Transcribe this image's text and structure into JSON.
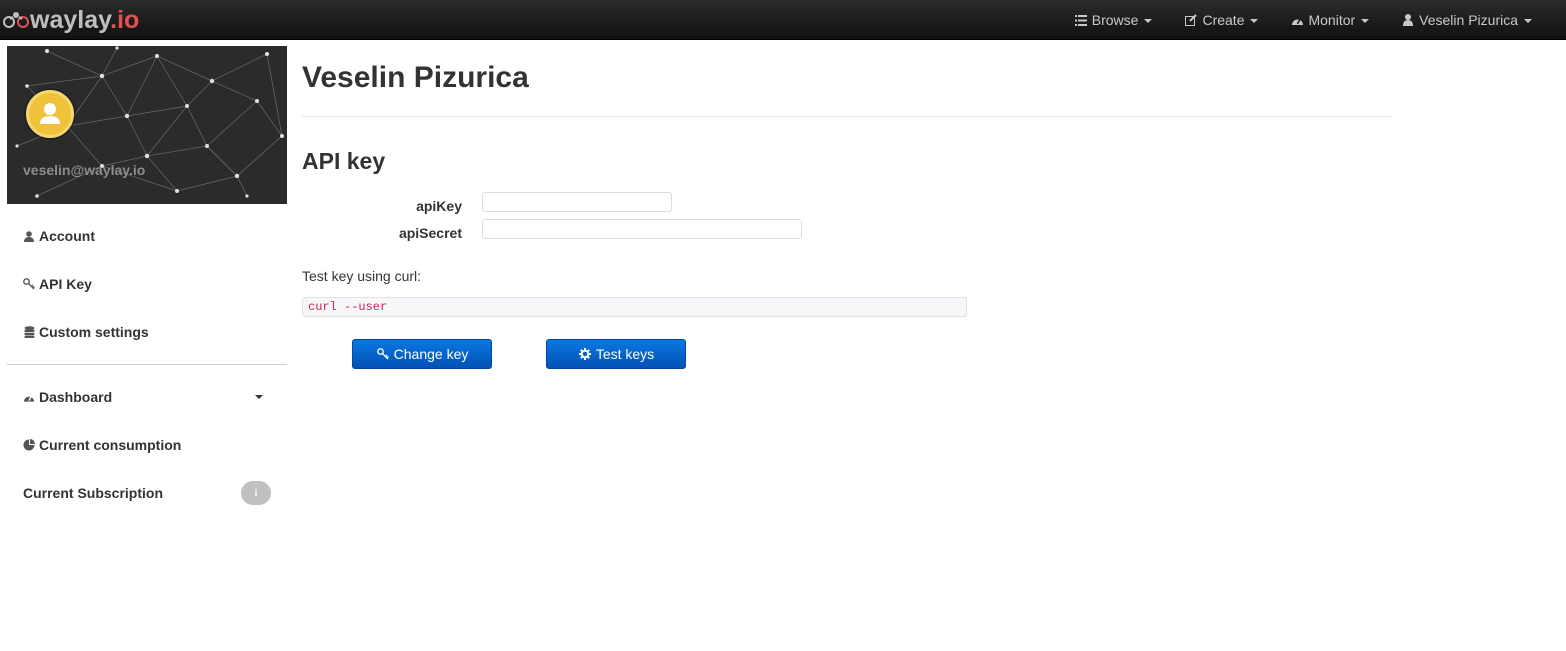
{
  "brand": {
    "name": "waylay",
    "tld": ".io",
    "logo_icon": "waylay-logo-icon"
  },
  "navbar": {
    "items": [
      {
        "label": "Browse",
        "icon": "list-icon"
      },
      {
        "label": "Create",
        "icon": "edit-icon"
      },
      {
        "label": "Monitor",
        "icon": "dashboard-icon"
      },
      {
        "label": "Veselin Pizurica",
        "icon": "user-icon"
      }
    ]
  },
  "sidebar": {
    "email": "veselin@waylay.io",
    "items": [
      {
        "label": "Account",
        "icon": "user-icon"
      },
      {
        "label": "API Key",
        "icon": "key-icon"
      },
      {
        "label": "Custom settings",
        "icon": "database-icon"
      }
    ],
    "items2": [
      {
        "label": "Dashboard",
        "icon": "dashboard-icon"
      },
      {
        "label": "Current consumption",
        "icon": "pie-chart-icon"
      },
      {
        "label": "Current Subscription",
        "badge": "i"
      }
    ]
  },
  "main": {
    "title": "Veselin Pizurica",
    "section_title": "API key",
    "api_key_label": "apiKey",
    "api_secret_label": "apiSecret",
    "curl_label": "Test key using curl:",
    "curl_command": "curl --user",
    "buttons": {
      "change_key": "Change key",
      "test_keys": "Test keys"
    }
  },
  "colors": {
    "navbar_bg": "#1a1a1a",
    "brand_tld": "#e8504f",
    "primary_button": "#0660c8",
    "avatar": "#f0c23b",
    "curl_text": "#c7254e"
  }
}
